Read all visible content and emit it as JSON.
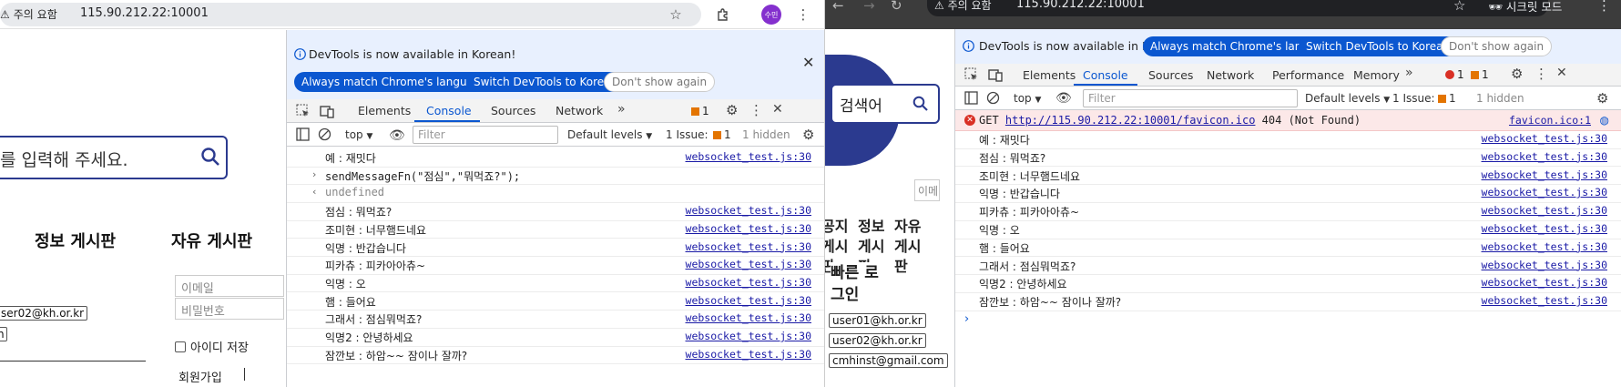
{
  "left": {
    "addressbar": {
      "security_label": "주의 요함",
      "url": "115.90.212.22:10001",
      "profile_initials": "수민"
    },
    "page": {
      "search_placeholder": "를 입력해 주세요.",
      "nav_boards": [
        "정보 게시판",
        "자유 게시판"
      ],
      "email_placeholder": "이메일",
      "password_placeholder": "비밀번호",
      "save_id_label": "아이디 저장",
      "signup_label": "회원가입",
      "email_chip": "ser02@kh.or.kr",
      "chip_partial": "n"
    },
    "devtools": {
      "info_text": "DevTools is now available in Korean!",
      "btn_match": "Always match Chrome's language",
      "btn_switch": "Switch DevTools to Korean",
      "btn_dont_show": "Don't show again",
      "tabs": [
        "Elements",
        "Console",
        "Sources",
        "Network"
      ],
      "issue_badge": "1",
      "context": "top",
      "filter_placeholder": "Filter",
      "levels": "Default levels",
      "issues": "1 Issue:",
      "issues_count": "1",
      "hidden": "1 hidden",
      "logs": [
        {
          "msg": "예 : 재밋다",
          "src": "websocket_test.js:30"
        },
        {
          "msg": "sendMessageFn(\"점심\",\"뭐먹죠?\");",
          "src": "",
          "kind": "input"
        },
        {
          "msg": "undefined",
          "src": "",
          "kind": "output"
        },
        {
          "msg": "점심 : 뭐먹죠?",
          "src": "websocket_test.js:30"
        },
        {
          "msg": "조미현 : 너무햄드네요",
          "src": "websocket_test.js:30"
        },
        {
          "msg": "익명 : 반갑습니다",
          "src": "websocket_test.js:30"
        },
        {
          "msg": "피카츄 : 피카아아츄~",
          "src": "websocket_test.js:30"
        },
        {
          "msg": "익명 : 오",
          "src": "websocket_test.js:30"
        },
        {
          "msg": "햄 : 들어요",
          "src": "websocket_test.js:30"
        },
        {
          "msg": "그래서 : 점심뭐먹죠?",
          "src": "websocket_test.js:30"
        },
        {
          "msg": "익명2 : 안녕하세요",
          "src": "websocket_test.js:30"
        },
        {
          "msg": "잠깐보 : 하암~~ 잠이나 잘까?",
          "src": "websocket_test.js:30"
        }
      ]
    }
  },
  "right": {
    "addressbar": {
      "security_label": "주의 요함",
      "url": "115.90.212.22:10001",
      "incognito": "시크릿 모드"
    },
    "page": {
      "search_label": "검색어",
      "partial_input": "이메",
      "nav_cols": [
        "공지\n게시\n판",
        "정보\n게시\n판",
        "자유\n게시\n판"
      ],
      "login_text": "빠른 로\n그인",
      "emails": [
        "user01@kh.or.kr",
        "user02@kh.or.kr",
        "cmhinst@gmail.com"
      ]
    },
    "devtools": {
      "info_text": "DevTools is now available in Korean!",
      "btn_match": "Always match Chrome's language",
      "btn_switch": "Switch DevTools to Korean",
      "btn_dont_show": "Don't show again",
      "tabs": [
        "Elements",
        "Console",
        "Sources",
        "Network",
        "Performance",
        "Memory"
      ],
      "err_count": "1",
      "warn_count": "1",
      "context": "top",
      "filter_placeholder": "Filter",
      "levels": "Default levels",
      "issues": "1 Issue:",
      "issues_count": "1",
      "hidden": "1 hidden",
      "error": {
        "msg_pre": "GET ",
        "url": "http://115.90.212.22:10001/favicon.ico",
        "msg_post": " 404 (Not Found)",
        "src": "favicon.ico:1"
      },
      "logs": [
        {
          "msg": "예 : 재밋다",
          "src": "websocket_test.js:30"
        },
        {
          "msg": "점심 : 뭐먹죠?",
          "src": "websocket_test.js:30"
        },
        {
          "msg": "조미현 : 너무햄드네요",
          "src": "websocket_test.js:30"
        },
        {
          "msg": "익명 : 반갑습니다",
          "src": "websocket_test.js:30"
        },
        {
          "msg": "피카츄 : 피카아아츄~",
          "src": "websocket_test.js:30"
        },
        {
          "msg": "익명 : 오",
          "src": "websocket_test.js:30"
        },
        {
          "msg": "햄 : 들어요",
          "src": "websocket_test.js:30"
        },
        {
          "msg": "그래서 : 점심뭐먹죠?",
          "src": "websocket_test.js:30"
        },
        {
          "msg": "익명2 : 안녕하세요",
          "src": "websocket_test.js:30"
        },
        {
          "msg": "잠깐보 : 하암~~ 잠이나 잘까?",
          "src": "websocket_test.js:30"
        }
      ]
    }
  }
}
